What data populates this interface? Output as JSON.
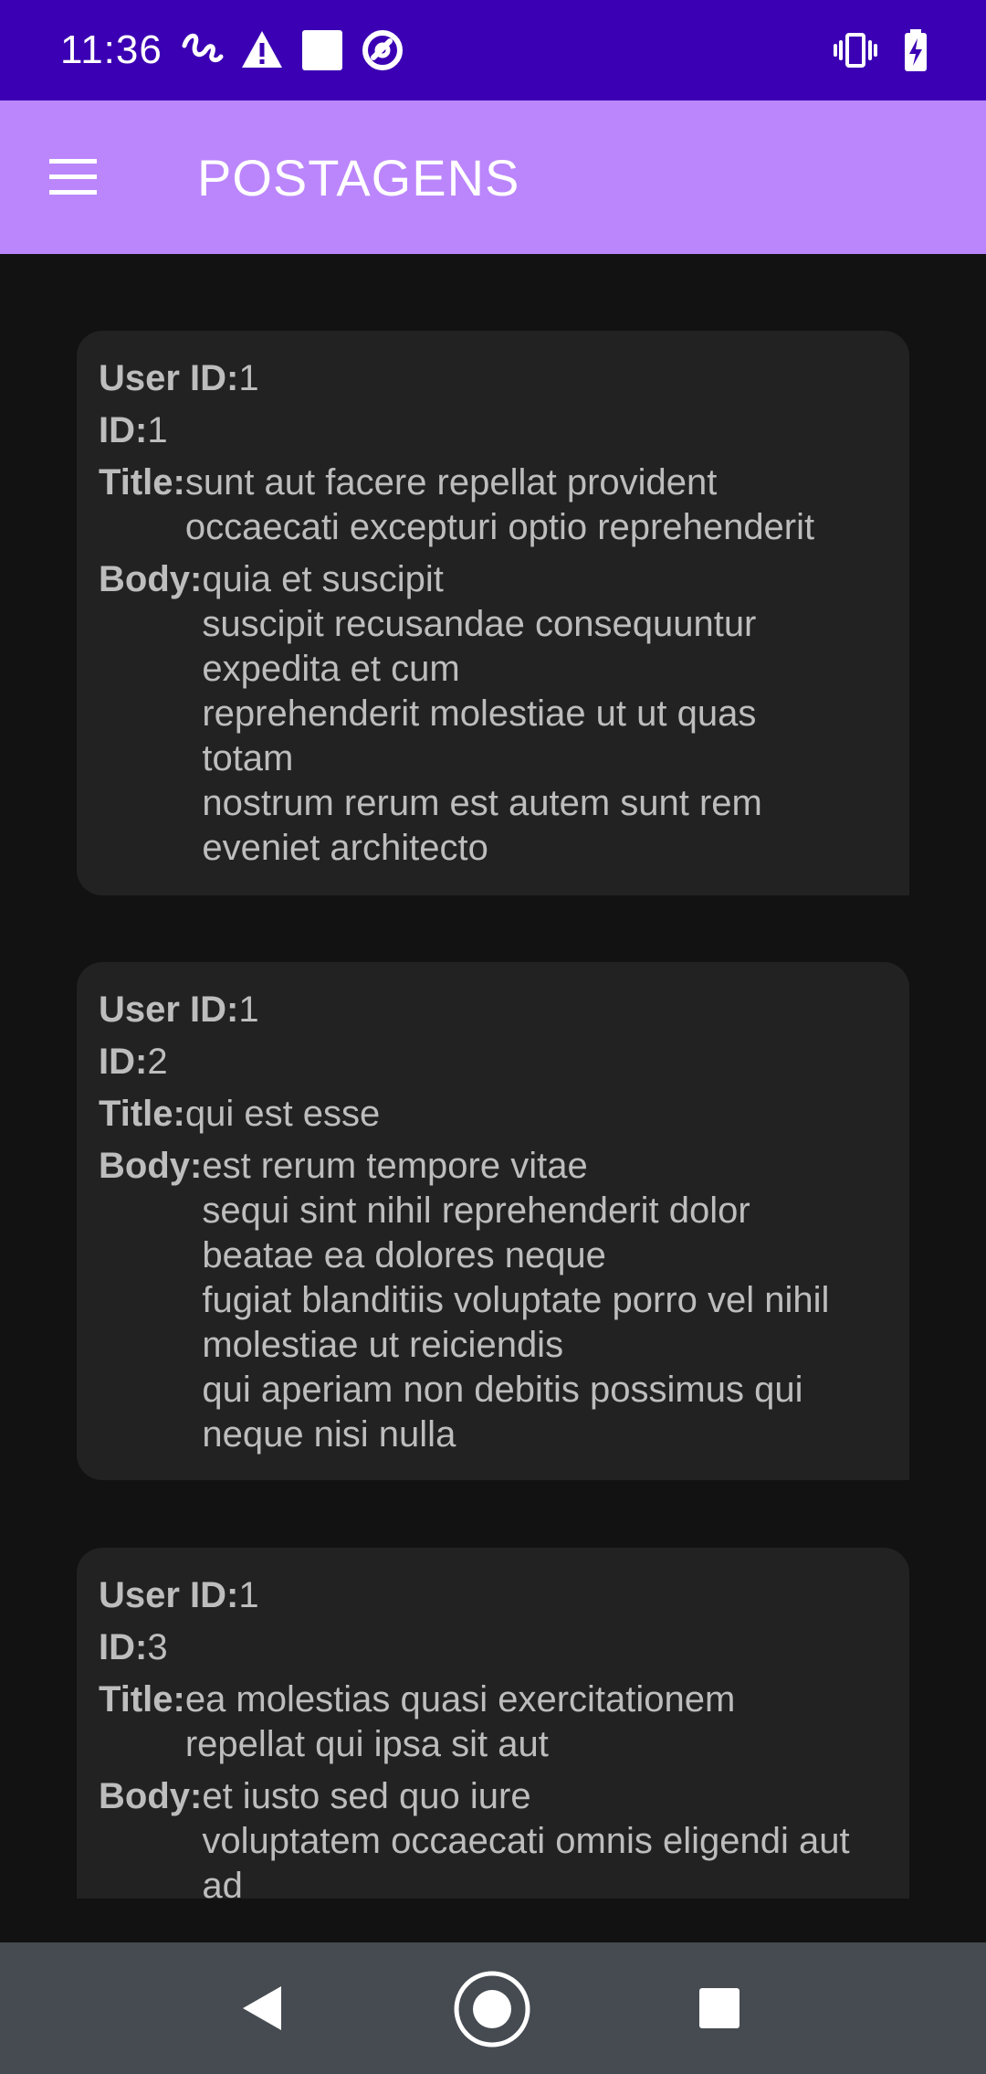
{
  "status_bar": {
    "time": "11:36",
    "left_icons": [
      "squiggle-notification-icon",
      "warning-icon",
      "white-square-icon",
      "at-sign-icon"
    ],
    "right_icons": [
      "vibrate-icon",
      "battery-charging-icon"
    ]
  },
  "app_bar": {
    "title": "POSTAGENS",
    "menu_icon": "hamburger-menu-icon"
  },
  "labels": {
    "user_id": "User ID:",
    "id": "ID:",
    "title": "Title:",
    "body": "Body:"
  },
  "posts": [
    {
      "user_id": "1",
      "id": "1",
      "title": "sunt aut facere repellat provident\noccaecati excepturi optio reprehenderit",
      "body": "quia et suscipit\nsuscipit recusandae consequuntur\nexpedita et cum\nreprehenderit molestiae ut ut quas\ntotam\nnostrum rerum est autem sunt rem\neveniet architecto"
    },
    {
      "user_id": "1",
      "id": "2",
      "title": "qui est esse",
      "body": "est rerum tempore vitae\nsequi sint nihil reprehenderit dolor\nbeatae ea dolores neque\nfugiat blanditiis voluptate porro vel nihil\nmolestiae ut reiciendis\nqui aperiam non debitis possimus qui\nneque nisi nulla"
    },
    {
      "user_id": "1",
      "id": "3",
      "title": "ea molestias quasi exercitationem\nrepellat qui ipsa sit aut",
      "body": "et iusto sed quo iure\nvoluptatem occaecati omnis eligendi aut\nad"
    }
  ],
  "nav_bar": {
    "buttons": [
      "back-icon",
      "home-icon",
      "recents-icon"
    ]
  },
  "colors": {
    "status_bar": "#3b00b3",
    "app_bar": "#bb86fc",
    "background": "#121212",
    "card": "#222222",
    "text": "#bdbdbd",
    "nav_bar": "#454b51"
  }
}
